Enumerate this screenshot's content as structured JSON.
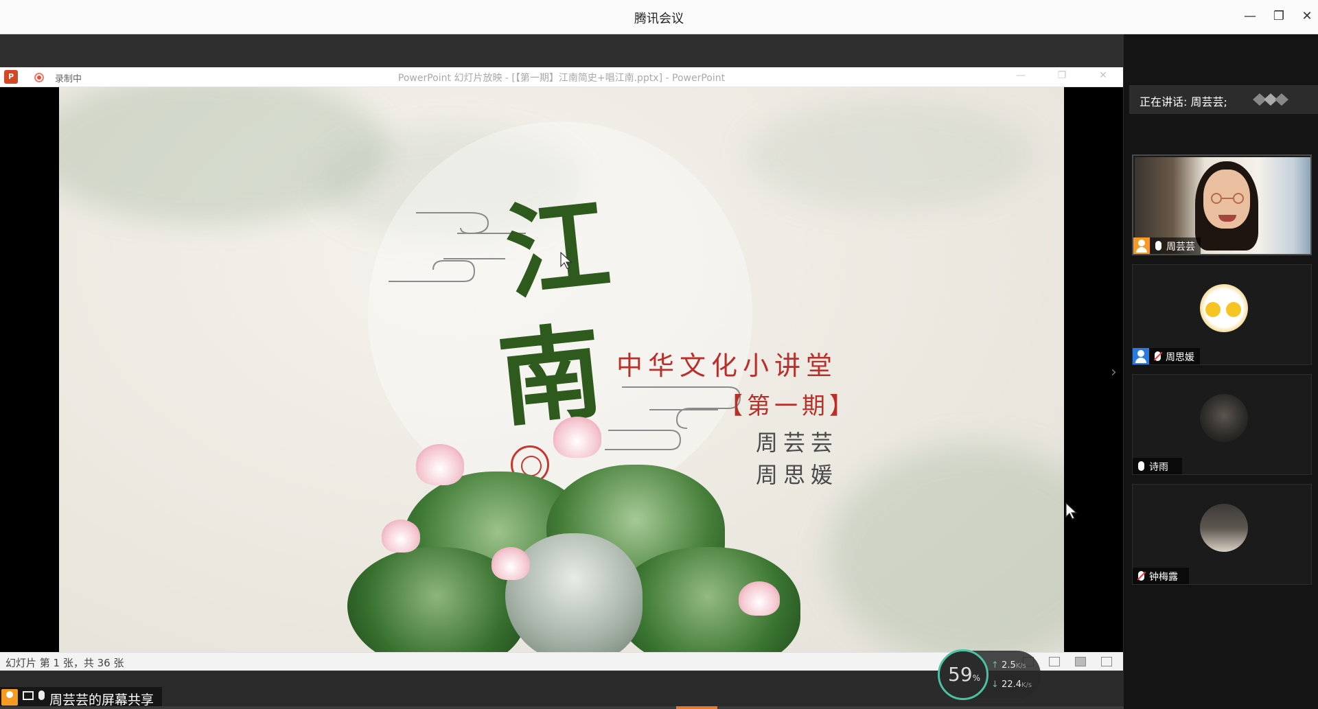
{
  "app": {
    "window_title": "腾讯会议",
    "window_controls": [
      "—",
      "❐",
      "✕"
    ]
  },
  "ppt": {
    "logo_text": "P",
    "recording_label": "录制中",
    "window_title": "PowerPoint 幻灯片放映 - [【第一期】江南简史+唱江南.pptx] - PowerPoint",
    "window_controls": [
      "—",
      "❐",
      "✕"
    ],
    "status_text": "幻灯片 第 1 张，共 36 张"
  },
  "slide": {
    "char_1": "江",
    "char_2": "南",
    "subtitle": "中华文化小讲堂",
    "issue": "【第一期】",
    "presenter_1": "周芸芸",
    "presenter_2": "周思媛"
  },
  "network": {
    "percent": "59",
    "percent_unit": "%",
    "upload": "2.5",
    "download": "22.4",
    "rate_unit": "K/s",
    "ring_color": "#4bc3a2"
  },
  "share": {
    "label": "周芸芸的屏幕共享"
  },
  "panel": {
    "speaking_text": "正在讲话: 周芸芸;",
    "participants": [
      {
        "name": "周芸芸",
        "mic": "on",
        "role": "host"
      },
      {
        "name": "周思媛",
        "mic": "off",
        "role": "member"
      },
      {
        "name": "诗雨",
        "mic": "on",
        "role": "none"
      },
      {
        "name": "钟梅露",
        "mic": "off",
        "role": "none"
      }
    ]
  },
  "colors": {
    "accent_orange": "#f59a23",
    "accent_blue": "#2a7ae2",
    "slide_red": "#b9302a",
    "slide_green": "#2e5a1e"
  }
}
